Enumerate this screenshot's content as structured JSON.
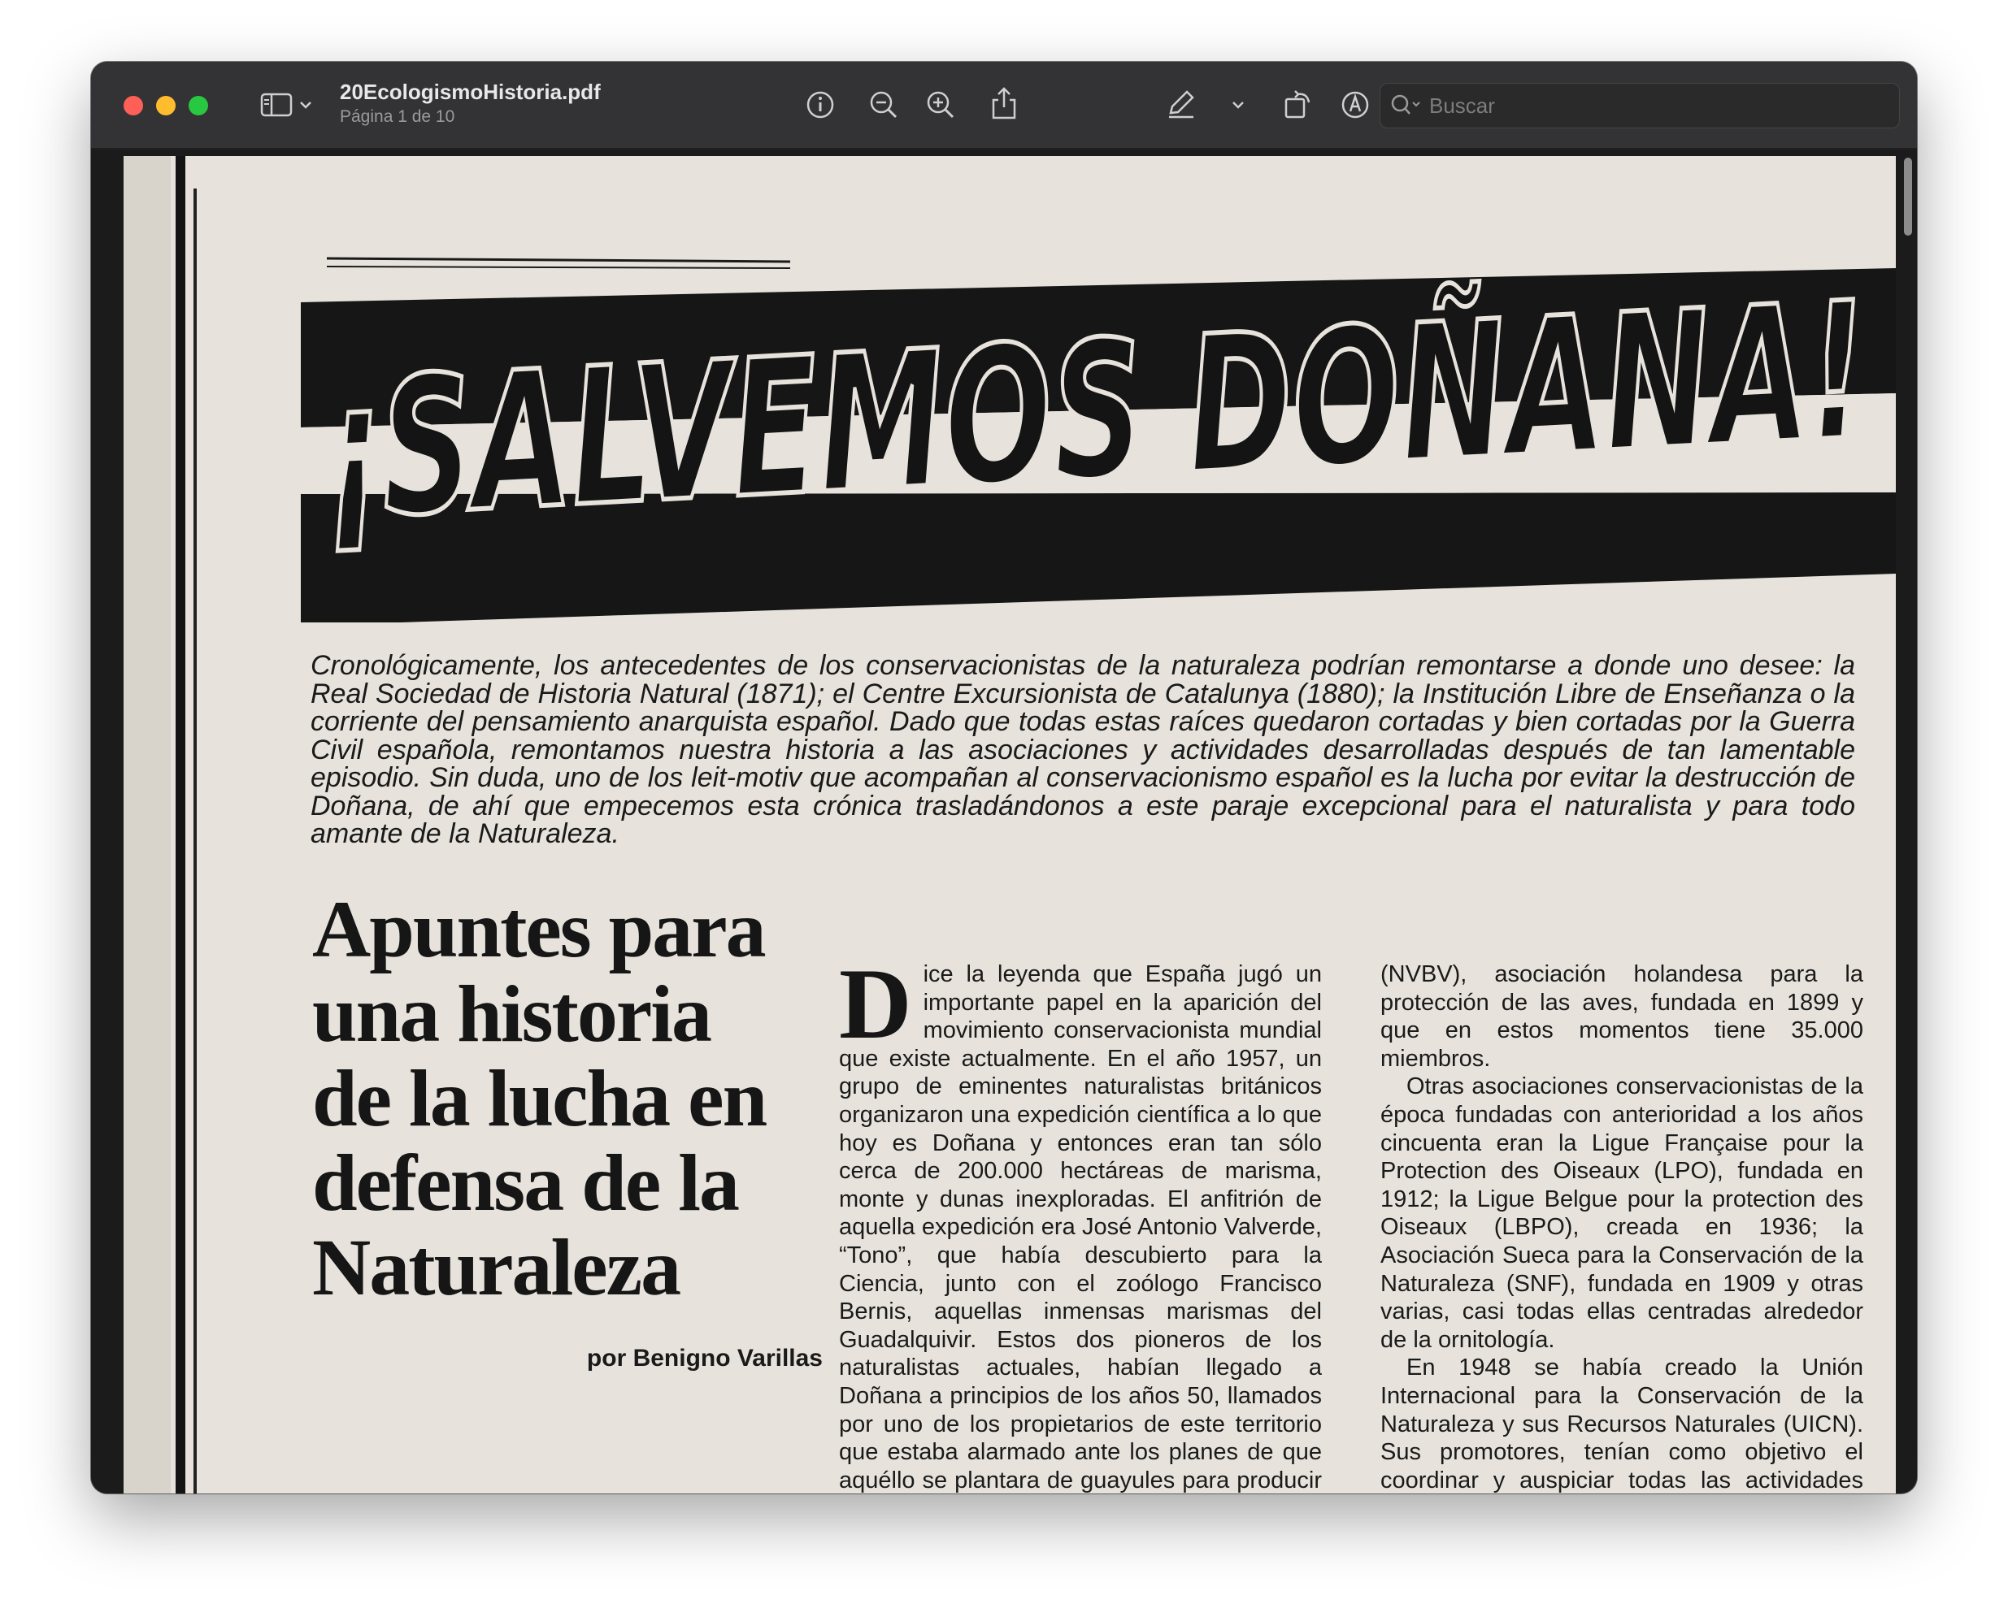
{
  "window": {
    "file_name": "20EcologismoHistoria.pdf",
    "page_indicator": "Página 1 de 10",
    "search_placeholder": "Buscar"
  },
  "toolbar": {
    "icons": [
      "sidebar-icon",
      "chevron-down-icon",
      "info-icon",
      "zoom-out-icon",
      "zoom-in-icon",
      "share-icon",
      "highlight-icon",
      "chevron-down-icon",
      "rotate-icon",
      "markup-icon",
      "signature-icon",
      "search-icon"
    ]
  },
  "article": {
    "banner_title": "¡SALVEMOS DOÑANA!",
    "intro": "Cronológicamente, los antecedentes de los conservacionistas de la naturaleza podrían remontarse a donde uno desee: la Real Sociedad de Historia Natural (1871); el Centre Excursionista de Catalunya (1880); la Institución Libre de Enseñanza o la corriente del pensamiento anarquista español. Dado que todas estas raíces quedaron cortadas y bien cortadas por la Guerra Civil española, remontamos nuestra historia a las asociaciones y actividades desarrolladas después de tan lamentable episodio. Sin duda, uno de los leit-motiv que acompañan al conservacionismo español es la lucha por evitar la destrucción de Doñana, de ahí que empecemos esta crónica trasladándonos a este paraje excepcional para el naturalista y para todo amante de la Naturaleza.",
    "headline": "Apuntes para una historia de la lucha en defensa de la Naturaleza",
    "byline": "por Benigno Varillas",
    "col1_dropcap": "D",
    "col1_text": "ice la leyenda que España jugó un importante papel en la aparición del movimiento conservacionista mundial que existe actualmente. En el año 1957, un grupo de eminentes naturalistas británicos organizaron una expedición científica a lo que hoy es Doñana y entonces eran tan sólo cerca de 200.000 hectáreas de marisma, monte y dunas inexploradas. El anfitrión de aquella expedición era José Antonio Valverde, “Tono”, que había descubierto para la Ciencia, junto con el zoólogo Francisco Bernis, aquellas inmensas marismas del Guadalquivir. Estos dos pioneros de los naturalistas actuales, habían llegado a Doñana a principios de los años 50, llamados por uno de los propietarios de este territorio que estaba alarmado ante los planes de que aquéllo se plantara de guayules para producir caucho y de eucaliptos, por imposición del Ministerio de Agricultura.",
    "col2_p1": "(NVBV), asociación holandesa para la protección de las aves, fundada en 1899 y que en estos momentos tiene 35.000 miembros.",
    "col2_p2": "Otras asociaciones conservacionistas de la época fundadas con anterioridad a los años cincuenta eran la Ligue Française pour la Protection des Oiseaux (LPO), fundada en 1912; la Ligue Belgue pour la protection des Oiseaux (LBPO), creada en 1936; la Asociación Sueca para la Conservación de la Naturaleza (SNF), fundada en 1909 y otras varias, casi todas ellas centradas alrededor de la ornitología.",
    "col2_p3": "En 1948 se había creado la Unión Internacional para la Conservación de la Naturaleza y sus Recursos Naturales (UICN). Sus promotores, tenían como objetivo el coordinar y auspiciar todas las actividades que pudieran tender a"
  }
}
